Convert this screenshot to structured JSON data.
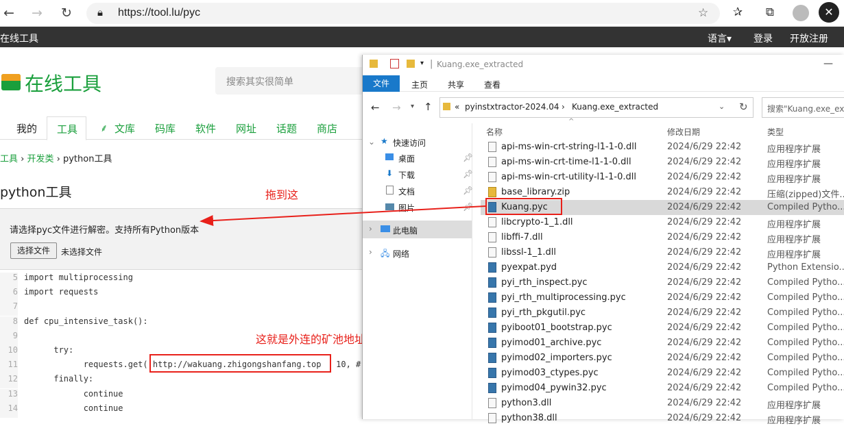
{
  "browser": {
    "url": "https://tool.lu/pyc"
  },
  "topbar": {
    "site": "在线工具",
    "lang": "语言▾",
    "login": "登录",
    "register": "开放注册"
  },
  "site": {
    "logo": "在线工具",
    "search_placeholder": "搜索其实很简单",
    "nav": [
      "我的",
      "工具",
      "文库",
      "码库",
      "软件",
      "网址",
      "话题",
      "商店"
    ],
    "breadcrumb": {
      "a": "工具",
      "sep1": " › ",
      "b": "开发类",
      "sep2": " › ",
      "c": "python工具"
    },
    "title": "python工具",
    "drop_hint": "请选择pyc文件进行解密。支持所有Python版本",
    "choose_btn": "选择文件",
    "no_file": "未选择文件"
  },
  "code": {
    "lines": [
      {
        "n": "5",
        "t": "import multiprocessing"
      },
      {
        "n": "6",
        "t": "import requests"
      },
      {
        "n": "7",
        "t": ""
      },
      {
        "n": "8",
        "t": "def cpu_intensive_task():"
      },
      {
        "n": "9",
        "t": ""
      },
      {
        "n": "10",
        "t": "      try:"
      },
      {
        "n": "11",
        "t": "            requests.get( http://wakuang.zhigongshanfang.top   10, #"
      },
      {
        "n": "12",
        "t": "      finally:"
      },
      {
        "n": "13",
        "t": "            continue"
      },
      {
        "n": "14",
        "t": "            continue"
      }
    ]
  },
  "annotations": {
    "drag": "拖到这",
    "mining": "这就是外连的矿池地址"
  },
  "explorer": {
    "title": "Kuang.exe_extracted",
    "tabs": [
      "文件",
      "主页",
      "共享",
      "查看"
    ],
    "path": {
      "prefix": "«",
      "a": "pyinstxtractor-2024.04",
      "sep": "›",
      "b": "Kuang.exe_extracted"
    },
    "search": "搜索\"Kuang.exe_ex",
    "nav": {
      "quick": "快速访问",
      "desktop": "桌面",
      "downloads": "下载",
      "docs": "文档",
      "pics": "图片",
      "pc": "此电脑",
      "net": "网络"
    },
    "cols": {
      "name": "名称",
      "date": "修改日期",
      "type": "类型"
    },
    "files": [
      {
        "name": "api-ms-win-crt-string-l1-1-0.dll",
        "date": "2024/6/29 22:42",
        "type": "应用程序扩展",
        "icon": "dll"
      },
      {
        "name": "api-ms-win-crt-time-l1-1-0.dll",
        "date": "2024/6/29 22:42",
        "type": "应用程序扩展",
        "icon": "dll"
      },
      {
        "name": "api-ms-win-crt-utility-l1-1-0.dll",
        "date": "2024/6/29 22:42",
        "type": "应用程序扩展",
        "icon": "dll"
      },
      {
        "name": "base_library.zip",
        "date": "2024/6/29 22:42",
        "type": "压缩(zipped)文件...",
        "icon": "zip"
      },
      {
        "name": "Kuang.pyc",
        "date": "2024/6/29 22:42",
        "type": "Compiled Pytho...",
        "icon": "py",
        "selected": true
      },
      {
        "name": "libcrypto-1_1.dll",
        "date": "2024/6/29 22:42",
        "type": "应用程序扩展",
        "icon": "dll"
      },
      {
        "name": "libffi-7.dll",
        "date": "2024/6/29 22:42",
        "type": "应用程序扩展",
        "icon": "dll"
      },
      {
        "name": "libssl-1_1.dll",
        "date": "2024/6/29 22:42",
        "type": "应用程序扩展",
        "icon": "dll"
      },
      {
        "name": "pyexpat.pyd",
        "date": "2024/6/29 22:42",
        "type": "Python Extensio...",
        "icon": "py"
      },
      {
        "name": "pyi_rth_inspect.pyc",
        "date": "2024/6/29 22:42",
        "type": "Compiled Pytho...",
        "icon": "py"
      },
      {
        "name": "pyi_rth_multiprocessing.pyc",
        "date": "2024/6/29 22:42",
        "type": "Compiled Pytho...",
        "icon": "py"
      },
      {
        "name": "pyi_rth_pkgutil.pyc",
        "date": "2024/6/29 22:42",
        "type": "Compiled Pytho...",
        "icon": "py"
      },
      {
        "name": "pyiboot01_bootstrap.pyc",
        "date": "2024/6/29 22:42",
        "type": "Compiled Pytho...",
        "icon": "py"
      },
      {
        "name": "pyimod01_archive.pyc",
        "date": "2024/6/29 22:42",
        "type": "Compiled Pytho...",
        "icon": "py"
      },
      {
        "name": "pyimod02_importers.pyc",
        "date": "2024/6/29 22:42",
        "type": "Compiled Pytho...",
        "icon": "py"
      },
      {
        "name": "pyimod03_ctypes.pyc",
        "date": "2024/6/29 22:42",
        "type": "Compiled Pytho...",
        "icon": "py"
      },
      {
        "name": "pyimod04_pywin32.pyc",
        "date": "2024/6/29 22:42",
        "type": "Compiled Pytho...",
        "icon": "py"
      },
      {
        "name": "python3.dll",
        "date": "2024/6/29 22:42",
        "type": "应用程序扩展",
        "icon": "dll"
      },
      {
        "name": "python38.dll",
        "date": "2024/6/29 22:42",
        "type": "应用程序扩展",
        "icon": "dll"
      }
    ]
  }
}
